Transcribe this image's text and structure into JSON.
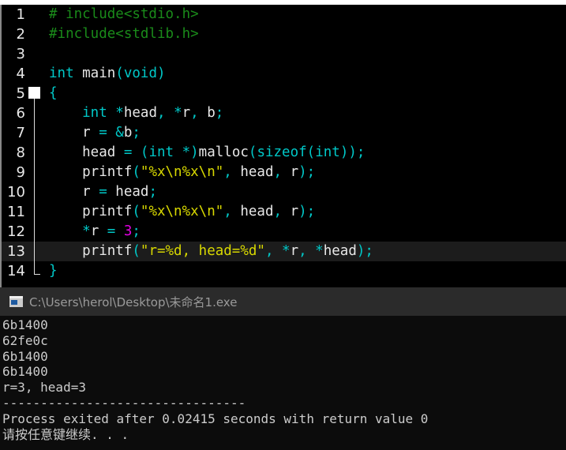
{
  "editor": {
    "lines": [
      {
        "n": "1",
        "tokens": [
          [
            "pre",
            "# include<stdio.h>"
          ]
        ]
      },
      {
        "n": "2",
        "tokens": [
          [
            "pre",
            "#include<stdlib.h>"
          ]
        ]
      },
      {
        "n": "3",
        "tokens": []
      },
      {
        "n": "4",
        "tokens": [
          [
            "kw",
            "int"
          ],
          [
            "id",
            " main"
          ],
          [
            "pu",
            "("
          ],
          [
            "kw",
            "void"
          ],
          [
            "pu",
            ")"
          ]
        ]
      },
      {
        "n": "5",
        "tokens": [
          [
            "pu",
            "{"
          ]
        ]
      },
      {
        "n": "6",
        "tokens": [
          [
            "kw",
            "    int"
          ],
          [
            "pu",
            " *"
          ],
          [
            "id",
            "head"
          ],
          [
            "pu",
            ", *"
          ],
          [
            "id",
            "r"
          ],
          [
            "pu",
            ", "
          ],
          [
            "id",
            "b"
          ],
          [
            "pu",
            ";"
          ]
        ]
      },
      {
        "n": "7",
        "tokens": [
          [
            "id",
            "    r"
          ],
          [
            "pu",
            " = &"
          ],
          [
            "id",
            "b"
          ],
          [
            "pu",
            ";"
          ]
        ]
      },
      {
        "n": "8",
        "tokens": [
          [
            "id",
            "    head"
          ],
          [
            "pu",
            " = ("
          ],
          [
            "kw",
            "int"
          ],
          [
            "pu",
            " *)"
          ],
          [
            "id",
            "malloc"
          ],
          [
            "pu",
            "("
          ],
          [
            "kw",
            "sizeof"
          ],
          [
            "pu",
            "("
          ],
          [
            "kw",
            "int"
          ],
          [
            "pu",
            "));"
          ]
        ]
      },
      {
        "n": "9",
        "tokens": [
          [
            "id",
            "    printf"
          ],
          [
            "pu",
            "("
          ],
          [
            "str",
            "\"%x\\n%x\\n\""
          ],
          [
            "pu",
            ", "
          ],
          [
            "id",
            "head"
          ],
          [
            "pu",
            ", "
          ],
          [
            "id",
            "r"
          ],
          [
            "pu",
            ");"
          ]
        ]
      },
      {
        "n": "10",
        "tokens": [
          [
            "id",
            "    r"
          ],
          [
            "pu",
            " = "
          ],
          [
            "id",
            "head"
          ],
          [
            "pu",
            ";"
          ]
        ]
      },
      {
        "n": "11",
        "tokens": [
          [
            "id",
            "    printf"
          ],
          [
            "pu",
            "("
          ],
          [
            "str",
            "\"%x\\n%x\\n\""
          ],
          [
            "pu",
            ", "
          ],
          [
            "id",
            "head"
          ],
          [
            "pu",
            ", "
          ],
          [
            "id",
            "r"
          ],
          [
            "pu",
            ");"
          ]
        ]
      },
      {
        "n": "12",
        "tokens": [
          [
            "pu",
            "    *"
          ],
          [
            "id",
            "r"
          ],
          [
            "pu",
            " = "
          ],
          [
            "num",
            "3"
          ],
          [
            "pu",
            ";"
          ]
        ]
      },
      {
        "n": "13",
        "tokens": [
          [
            "id",
            "    printf"
          ],
          [
            "pu",
            "("
          ],
          [
            "str",
            "\"r=%d, head=%d\""
          ],
          [
            "pu",
            ", *"
          ],
          [
            "id",
            "r"
          ],
          [
            "pu",
            ", *"
          ],
          [
            "id",
            "head"
          ],
          [
            "pu",
            ");"
          ]
        ],
        "current": true
      },
      {
        "n": "14",
        "tokens": [
          [
            "pu",
            "}"
          ]
        ]
      }
    ]
  },
  "console": {
    "title": "C:\\Users\\herol\\Desktop\\未命名1.exe",
    "output": [
      "6b1400",
      "62fe0c",
      "6b1400",
      "6b1400",
      "r=3, head=3",
      "--------------------------------",
      "Process exited after 0.02415 seconds with return value 0",
      "请按任意键继续. . ."
    ]
  }
}
